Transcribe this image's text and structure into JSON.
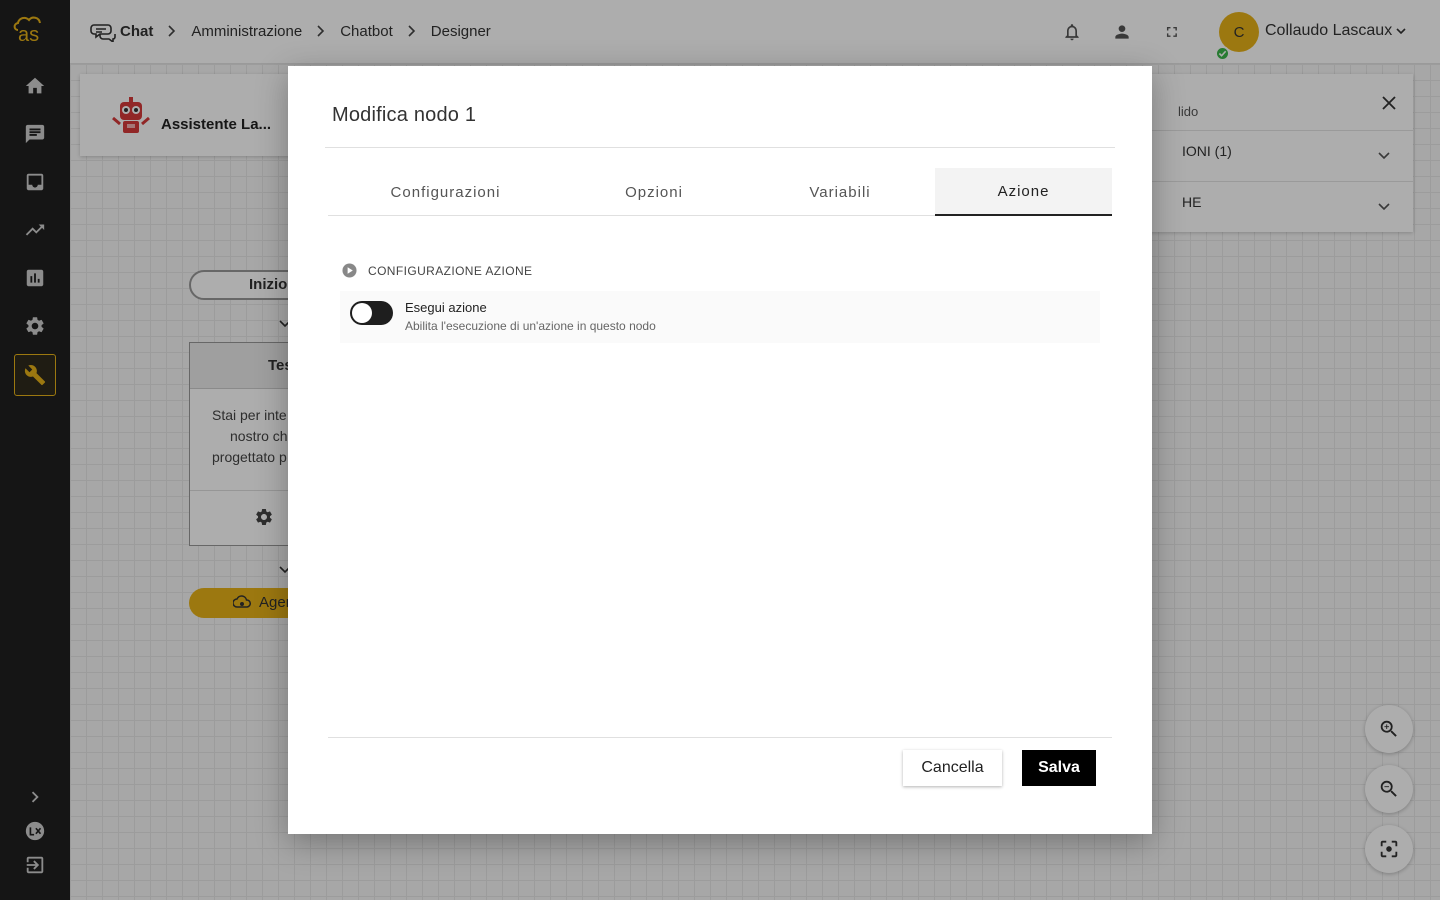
{
  "colors": {
    "accent": "#e6b219",
    "sidebar": "#1f1f1f",
    "status_online": "#3bb54a"
  },
  "logo": {
    "text": "as"
  },
  "sidebar": {
    "items": [
      {
        "icon": "home-icon"
      },
      {
        "icon": "chat-icon"
      },
      {
        "icon": "inbox-icon"
      },
      {
        "icon": "trending-icon"
      },
      {
        "icon": "bar-chart-icon"
      },
      {
        "icon": "settings-icon"
      },
      {
        "icon": "wrench-icon",
        "active": true
      }
    ],
    "bottom": [
      {
        "icon": "chevron-right-icon"
      },
      {
        "icon": "lx-icon"
      },
      {
        "icon": "logout-icon"
      }
    ]
  },
  "header": {
    "breadcrumb": [
      "Chat",
      "Amministrazione",
      "Chatbot",
      "Designer"
    ],
    "user": {
      "initial": "C",
      "name": "Collaudo Lascaux"
    }
  },
  "canvas": {
    "bot_name": "Assistente La...",
    "start_label": "Inizio",
    "node_title": "Test",
    "node_text": [
      "Stai per inte",
      "nostro ch",
      "progettato p"
    ],
    "agent_label": "Agente",
    "panel": {
      "top_label": "lido",
      "row1": "IONI (1)",
      "row2": "HE"
    }
  },
  "modal": {
    "title": "Modifica nodo 1",
    "tabs": [
      "Configurazioni",
      "Opzioni",
      "Variabili",
      "Azione"
    ],
    "active_tab": "Azione",
    "section_title": "CONFIGURAZIONE AZIONE",
    "option": {
      "title": "Esegui azione",
      "description": "Abilita l'esecuzione di un'azione in questo nodo",
      "enabled": false
    },
    "buttons": {
      "cancel": "Cancella",
      "save": "Salva"
    }
  }
}
